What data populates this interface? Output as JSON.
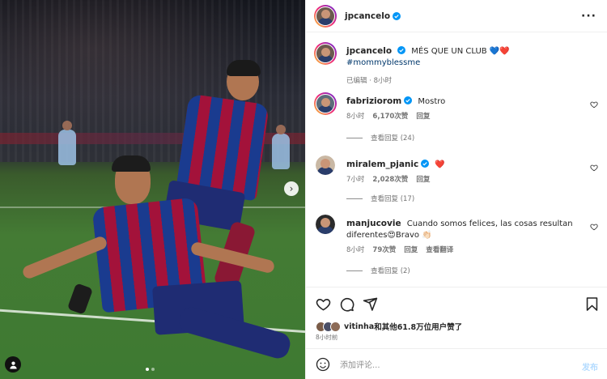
{
  "header": {
    "username": "jpcancelo"
  },
  "caption": {
    "username": "jpcancelo",
    "text": "MÉS QUE UN CLUB",
    "emojis": "💙❤️",
    "hashtag": "#mommyblessme",
    "meta": "已编辑 · 8小时"
  },
  "comments": [
    {
      "username": "fabriziorom",
      "text": "Mostro",
      "time": "8小时",
      "likes": "6,170次赞",
      "reply": "回复",
      "view_replies": "查看回复 (24)"
    },
    {
      "username": "miralem_pjanic",
      "text": "❤️",
      "time": "7小时",
      "likes": "2,028次赞",
      "reply": "回复",
      "view_replies": "查看回复 (17)"
    },
    {
      "username": "manjucovie",
      "text": "Cuando somos felices, las cosas resultan diferentes😍Bravo 👏🏻",
      "time": "8小时",
      "likes": "79次赞",
      "reply": "回复",
      "translate": "查看翻译",
      "view_replies": "查看回复 (2)"
    }
  ],
  "actions": {
    "likes_user": "vitinha",
    "likes_rest": "和其他61.8万位用户赞了",
    "time_ago": "8小时前"
  },
  "add_comment": {
    "placeholder": "添加评论...",
    "post_label": "发布"
  },
  "icons": [
    "more-icon",
    "verified-icon",
    "heart-icon",
    "comment-icon",
    "share-icon",
    "bookmark-icon",
    "emoji-icon",
    "user-tag-icon",
    "chevron-right-icon"
  ],
  "colors": {
    "verified": "#0095f6",
    "link": "#00376b",
    "muted": "#737373",
    "post_button": "#b3dbff"
  }
}
